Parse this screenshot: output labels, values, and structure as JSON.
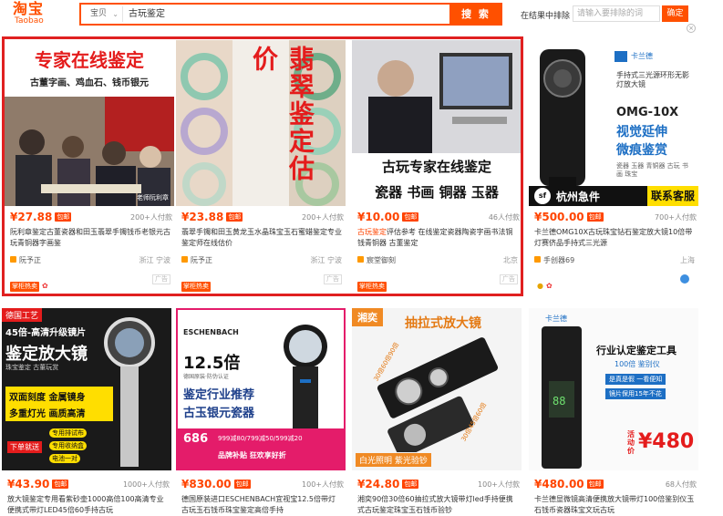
{
  "header": {
    "logo_cn": "淘宝",
    "logo_en": "Taobao",
    "scope_label": "宝贝",
    "query": "古玩鉴定",
    "search_button": "搜 索",
    "exclude_label": "在结果中排除",
    "exclude_placeholder": "请输入要排除的词",
    "exclude_button": "确定"
  },
  "row1": [
    {
      "thumb_line1": "专家在线鉴定",
      "thumb_line2": "古董字画、鸡血石、钱币银元",
      "thumb_caption": "老师阮利章",
      "price": "¥27.88",
      "baoyou": "包邮",
      "sales": "200+人付款",
      "title_pre": "阮利章鉴定古董瓷器和田玉翡翠手镯钱币老银元古玩青铜器字画鉴",
      "title_hl": "",
      "shop": "阮予正",
      "location": "浙江 宁波",
      "tag": "掌柜热卖",
      "ad": "广告"
    },
    {
      "thumb_line1": "翡翠鉴定估价",
      "price": "¥23.88",
      "baoyou": "包邮",
      "sales": "200+人付款",
      "title_pre": "翡翠手镯和田玉黄龙玉水晶珠宝玉石蜜蜡鉴定专业鉴定师在线估价",
      "title_hl": "",
      "shop": "阮予正",
      "location": "浙江 宁波",
      "tag": "掌柜热卖",
      "ad": "广告"
    },
    {
      "thumb_line1": "古玩专家在线鉴定",
      "thumb_line2": "瓷器 书画 铜器 玉器",
      "price": "¥10.00",
      "baoyou": "包邮",
      "sales": "46人付款",
      "title_hl": "古玩鉴定",
      "title_pre": "评估参考 在线鉴定瓷器陶瓷字画书法铜钱青铜器 古董鉴定",
      "shop": "宸堂御刻",
      "location": "北京",
      "tag": "掌柜热卖",
      "ad": "广告"
    },
    {
      "thumb_brand": "卡兰德",
      "thumb_sub": "手持式三光源环形无影灯放大镜",
      "thumb_model": "OMG-10X",
      "thumb_line1": "视觉延伸",
      "thumb_line2": "微痕鉴赏",
      "thumb_uses": "瓷器 玉器 青铜器 古玩 书画 珠宝",
      "thumb_sf": "杭州急件",
      "thumb_kefu": "联系客服",
      "price": "¥500.00",
      "baoyou": "包邮",
      "sales": "700+人付款",
      "title_pre": "卡兰德OMG10X古玩珠宝钻石鉴定放大镜10倍带灯赛侪品手持式三光源",
      "title_hl": "",
      "shop": "手创器69",
      "location": "上海"
    }
  ],
  "row2": [
    {
      "thumb_tag": "德国工艺",
      "thumb_line1": "45倍-高清升级镜片",
      "thumb_line2": "鉴定放大镜",
      "thumb_line3": "珠宝鉴定 古董玩赏",
      "thumb_feature1": "双面刻度 金属镜身",
      "thumb_feature2": "多重灯光 画质高清",
      "thumb_btn1": "专用排试布",
      "thumb_btn2": "专用收纳盒",
      "thumb_btn3": "电池一对",
      "thumb_xd": "下单就送",
      "price": "¥43.90",
      "baoyou": "包邮",
      "sales": "1000+人付款",
      "title_pre": "放大镜鉴定专用看紫砂壶1000高倍100高清专业便携式带灯LED45倍60手持古玩",
      "title_hl": ""
    },
    {
      "thumb_brand": "ESCHENBACH",
      "thumb_mag": "12.5倍",
      "thumb_sub": "德国原装·防伪认证",
      "thumb_line1": "鉴定行业推荐",
      "thumb_line2": "古玉银元瓷器",
      "thumb_price": "686",
      "thumb_coupon": "999减80/799减50/599减20",
      "thumb_promo": "品牌补贴 狂欢享好折",
      "price": "¥830.00",
      "baoyou": "包邮",
      "sales": "100+人付款",
      "title_pre": "德国原装进口ESCHENBACH宜视宝12.5倍带灯古玩玉石钱币珠宝鉴定高倍手持",
      "title_hl": ""
    },
    {
      "thumb_tag": "湘奕",
      "thumb_line1": "抽拉式放大镜",
      "thumb_curve1": "30倍60倍90倍",
      "thumb_curve2": "30倍45倍60倍",
      "thumb_foot": "白光照明 紫光验钞",
      "price": "¥24.80",
      "baoyou": "包邮",
      "sales": "100+人付款",
      "title_pre": "湘奕90倍30倍60抽拉式放大镜带灯led手持便携式古玩鉴定珠宝玉石钱币验钞",
      "title_hl": ""
    },
    {
      "thumb_brand": "卡兰德",
      "thumb_line1": "行业认定鉴定工具",
      "thumb_line2": "100倍 鉴别仪",
      "thumb_bullet1": "是真是假 一看便知",
      "thumb_bullet2": "镜片保用15年不花",
      "thumb_price_label": "活动价",
      "thumb_price": "¥480",
      "price": "¥480.00",
      "baoyou": "包邮",
      "sales": "68人付款",
      "title_pre": "卡兰德显微镜高清便携放大镜带灯100倍鉴别仪玉石钱币瓷器珠宝文玩古玩",
      "title_hl": ""
    }
  ],
  "colors": {
    "accent": "#ff5000",
    "price": "#ff4400",
    "ad_frame": "#e02020"
  }
}
